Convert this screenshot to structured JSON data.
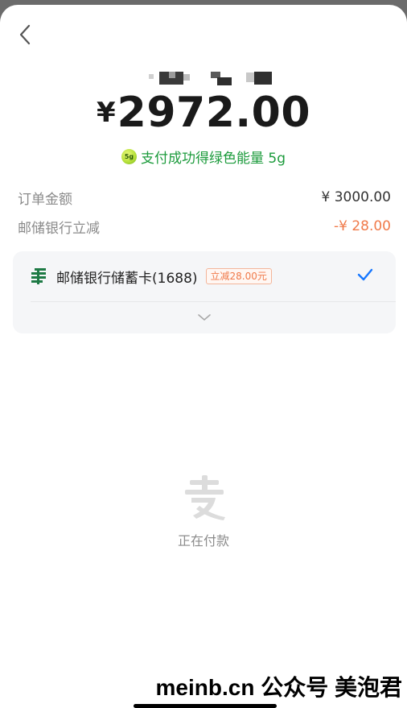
{
  "header": {
    "back_icon": "chevron-left-icon"
  },
  "payment": {
    "currency_symbol": "¥",
    "amount": "2972.00",
    "energy_ball_text": "5g",
    "energy_text": "支付成功得绿色能量 5g"
  },
  "summary": {
    "order_label": "订单金额",
    "order_value": "¥ 3000.00",
    "discount_label": "邮储银行立减",
    "discount_value": "-¥ 28.00"
  },
  "method": {
    "bank_icon": "postal-bank-icon",
    "name": "邮储银行储蓄卡(1688)",
    "badge": "立减28.00元",
    "check_icon": "checkmark-icon",
    "expand_icon": "chevron-down-icon"
  },
  "loading": {
    "logo_icon": "alipay-logo-icon",
    "text": "正在付款"
  },
  "watermark": {
    "text": "meinb.cn  公众号 美泡君"
  },
  "colors": {
    "energy_green": "#1c9b3c",
    "discount_orange": "#f07a4a",
    "check_blue": "#1677ff",
    "bank_green": "#1e7a45"
  }
}
